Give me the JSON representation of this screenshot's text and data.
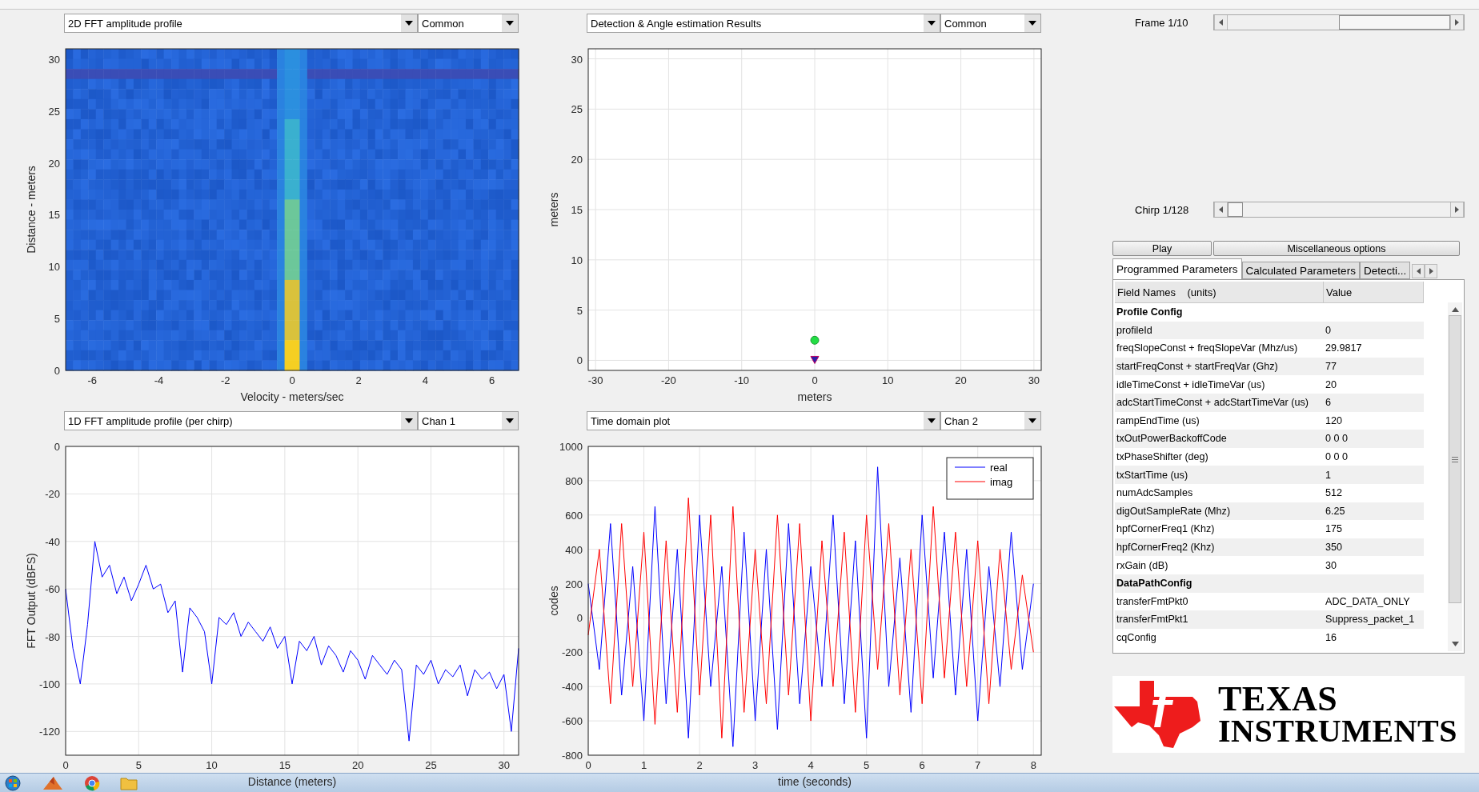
{
  "plots": [
    {
      "selector": "2D FFT amplitude profile",
      "channel": "Common",
      "axes": {
        "xlabel": "Velocity - meters/sec",
        "ylabel": "Distance - meters",
        "xticks": [
          "-6",
          "-4",
          "-2",
          "0",
          "2",
          "4",
          "6"
        ],
        "yticks": [
          "30",
          "25",
          "20",
          "15",
          "10",
          "5",
          "0"
        ]
      }
    },
    {
      "selector": "Detection & Angle estimation Results",
      "channel": "Common",
      "chart_data": {
        "type": "scatter",
        "xlabel": "meters",
        "ylabel": "meters",
        "xlim": [
          -31,
          31
        ],
        "ylim": [
          -1,
          31
        ],
        "xticks": [
          -30,
          -20,
          -10,
          0,
          10,
          20,
          30
        ],
        "yticks": [
          0,
          5,
          10,
          15,
          20,
          25,
          30
        ],
        "grid": true,
        "x": [
          0
        ],
        "series": [
          {
            "color": "#22dd44",
            "values": [
              2
            ]
          },
          {
            "color": "#2a1fa8",
            "values": [
              0
            ]
          }
        ]
      }
    },
    {
      "selector": "1D FFT amplitude profile (per chirp)",
      "channel": "Chan 1",
      "chart_data": {
        "type": "line",
        "xlabel": "Distance (meters)",
        "ylabel": "FFT Output (dBFS)",
        "xlim": [
          0,
          31
        ],
        "ylim": [
          -130,
          0
        ],
        "xticks": [
          0,
          5,
          10,
          15,
          20,
          25,
          30
        ],
        "yticks": [
          -120,
          -100,
          -80,
          -60,
          -40,
          -20,
          0
        ],
        "grid": true,
        "x": [
          0,
          0.5,
          1,
          1.5,
          2,
          2.5,
          3,
          3.5,
          4,
          4.5,
          5,
          5.5,
          6,
          6.5,
          7,
          7.5,
          8,
          8.5,
          9,
          9.5,
          10,
          10.5,
          11,
          11.5,
          12,
          12.5,
          13,
          13.5,
          14,
          14.5,
          15,
          15.5,
          16,
          16.5,
          17,
          17.5,
          18,
          18.5,
          19,
          19.5,
          20,
          20.5,
          21,
          21.5,
          22,
          22.5,
          23,
          23.5,
          24,
          24.5,
          25,
          25.5,
          26,
          26.5,
          27,
          27.5,
          28,
          28.5,
          29,
          29.5,
          30,
          30.5,
          31
        ],
        "series": [
          {
            "color": "#0000ff",
            "values": [
              -60,
              -85,
              -100,
              -75,
              -40,
              -55,
              -50,
              -62,
              -55,
              -65,
              -58,
              -50,
              -60,
              -58,
              -70,
              -65,
              -95,
              -68,
              -72,
              -78,
              -100,
              -72,
              -75,
              -70,
              -80,
              -74,
              -78,
              -82,
              -76,
              -85,
              -80,
              -100,
              -82,
              -86,
              -80,
              -92,
              -84,
              -88,
              -95,
              -86,
              -90,
              -98,
              -88,
              -92,
              -96,
              -90,
              -94,
              -124,
              -92,
              -96,
              -90,
              -100,
              -94,
              -97,
              -92,
              -105,
              -94,
              -98,
              -95,
              -102,
              -96,
              -120,
              -85
            ]
          }
        ]
      }
    },
    {
      "selector": "Time domain plot",
      "channel": "Chan 2",
      "chart_data": {
        "type": "line",
        "xlabel": "time  (seconds)",
        "ylabel": "codes",
        "xlim": [
          0,
          8.14
        ],
        "ylim": [
          -800,
          1000
        ],
        "xticks": [
          0,
          1,
          2,
          3,
          4,
          5,
          6,
          7,
          8
        ],
        "yticks": [
          -800,
          -600,
          -400,
          -200,
          0,
          200,
          400,
          600,
          800,
          1000
        ],
        "grid": true,
        "legend": true,
        "x": [
          0,
          0.2,
          0.4,
          0.6,
          0.8,
          1,
          1.2,
          1.4,
          1.6,
          1.8,
          2,
          2.2,
          2.4,
          2.6,
          2.8,
          3,
          3.2,
          3.4,
          3.6,
          3.8,
          4,
          4.2,
          4.4,
          4.6,
          4.8,
          5,
          5.2,
          5.4,
          5.6,
          5.8,
          6,
          6.2,
          6.4,
          6.6,
          6.8,
          7,
          7.2,
          7.4,
          7.6,
          7.8,
          8
        ],
        "series": [
          {
            "name": "real",
            "color": "#0000ff",
            "values": [
              200,
              -300,
              550,
              -450,
              300,
              -600,
              650,
              -500,
              400,
              -700,
              600,
              -400,
              300,
              -750,
              500,
              -600,
              400,
              -650,
              550,
              -500,
              300,
              -400,
              600,
              -500,
              450,
              -700,
              880,
              -400,
              350,
              -550,
              600,
              -350,
              500,
              -450,
              400,
              -600,
              300,
              -400,
              500,
              -300,
              200
            ]
          },
          {
            "name": "imag",
            "color": "#ff0000",
            "values": [
              -100,
              400,
              -500,
              550,
              -400,
              500,
              -620,
              450,
              -550,
              700,
              -450,
              600,
              -700,
              650,
              -550,
              400,
              -500,
              600,
              -450,
              550,
              -600,
              450,
              -400,
              500,
              -550,
              600,
              -300,
              550,
              -450,
              400,
              -500,
              650,
              -350,
              500,
              -400,
              450,
              -500,
              400,
              -300,
              250,
              -200
            ]
          }
        ]
      }
    }
  ],
  "sliders": [
    {
      "label": "Frame 1/10",
      "level": 1
    },
    {
      "label": "Chirp 1/128",
      "level": 0
    }
  ],
  "buttons": [
    "Play",
    "Miscellaneous options"
  ],
  "tabs": [
    {
      "label": "Programmed Parameters",
      "selected": true
    },
    {
      "label": "Calculated Parameters",
      "selected": false
    },
    {
      "label": "Detecti...",
      "selected": false
    }
  ],
  "table": {
    "columns": [
      "Field Names    (units)",
      "Value"
    ],
    "rows": [
      {
        "kind": "section",
        "name": "Profile Config"
      },
      {
        "kind": "field",
        "name": "profileId",
        "value": "0"
      },
      {
        "kind": "field",
        "name": "freqSlopeConst + freqSlopeVar (Mhz/us)",
        "value": "29.9817"
      },
      {
        "kind": "field",
        "name": "startFreqConst + startFreqVar (Ghz)",
        "value": "77"
      },
      {
        "kind": "field",
        "name": "idleTimeConst + idleTimeVar (us)",
        "value": "20"
      },
      {
        "kind": "field",
        "name": "adcStartTimeConst + adcStartTimeVar (us)",
        "value": "6"
      },
      {
        "kind": "field",
        "name": "rampEndTime (us)",
        "value": "120"
      },
      {
        "kind": "field",
        "name": "txOutPowerBackoffCode",
        "value": "0 0 0"
      },
      {
        "kind": "field",
        "name": "txPhaseShifter (deg)",
        "value": "0 0 0"
      },
      {
        "kind": "field",
        "name": "txStartTime (us)",
        "value": "1"
      },
      {
        "kind": "field",
        "name": "numAdcSamples",
        "value": "512"
      },
      {
        "kind": "field",
        "name": "digOutSampleRate (Mhz)",
        "value": "6.25"
      },
      {
        "kind": "field",
        "name": "hpfCornerFreq1 (Khz)",
        "value": "175"
      },
      {
        "kind": "field",
        "name": "hpfCornerFreq2 (Khz)",
        "value": "350"
      },
      {
        "kind": "field",
        "name": "rxGain (dB)",
        "value": "30"
      },
      {
        "kind": "section",
        "name": "DataPathConfig"
      },
      {
        "kind": "field",
        "name": "transferFmtPkt0",
        "value": "ADC_DATA_ONLY"
      },
      {
        "kind": "field",
        "name": "transferFmtPkt1",
        "value": "Suppress_packet_1"
      },
      {
        "kind": "field",
        "name": "cqConfig",
        "value": "16"
      }
    ]
  },
  "logo": {
    "line_1": "TEXAS",
    "line_2": "INSTRUMENTS"
  }
}
